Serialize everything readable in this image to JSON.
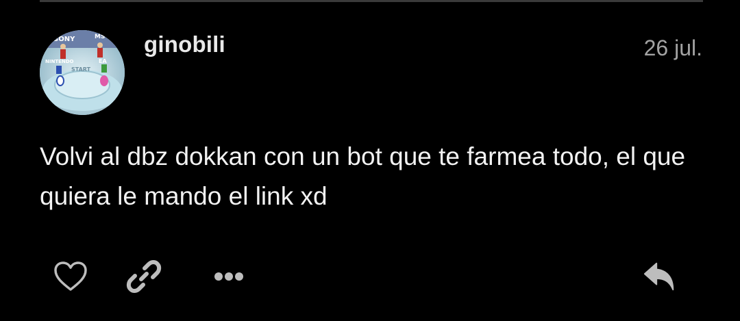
{
  "post": {
    "author": "ginobili",
    "date": "26 jul.",
    "body": "Volvi al dbz dokkan con un bot que te farmea todo, el que quiera le mando el link xd"
  },
  "avatar": {
    "labels": {
      "top_left": "SONY",
      "top_right": "MS",
      "mid_left": "NINTENDO",
      "mid_right": "EA",
      "center": "START"
    }
  },
  "actions": {
    "icons": [
      "heart-icon",
      "link-icon",
      "more-icon",
      "reply-icon"
    ]
  },
  "colors": {
    "background": "#000000",
    "text": "#f2f2f2",
    "muted": "#a3a3a3",
    "icon": "#bdbdbd"
  }
}
